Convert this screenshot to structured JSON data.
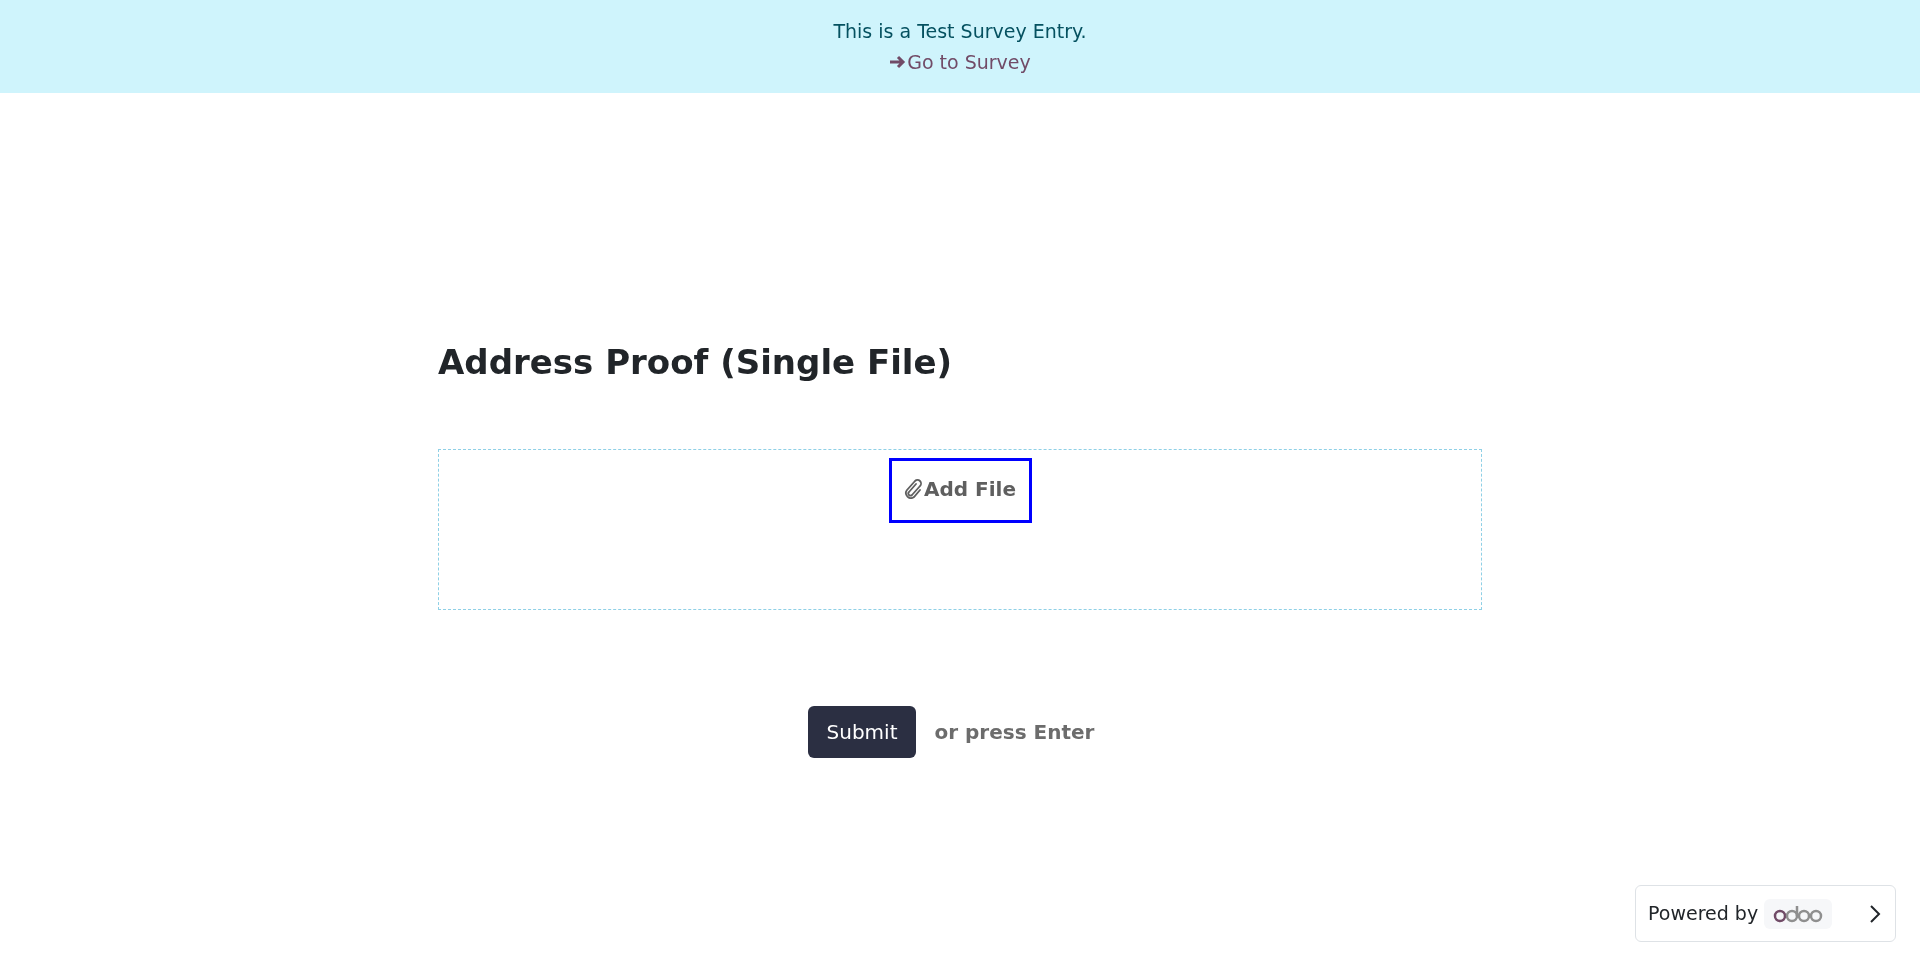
{
  "banner": {
    "text": "This is a Test Survey Entry.",
    "link": "Go to Survey"
  },
  "question": {
    "title": "Address Proof (Single File)"
  },
  "upload": {
    "button_label": "Add File",
    "focused": true
  },
  "submit": {
    "label": "Submit",
    "hint": "or press Enter"
  },
  "powered_by": {
    "text": "Powered by"
  }
}
